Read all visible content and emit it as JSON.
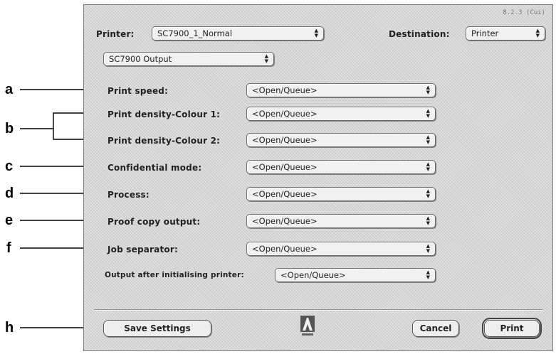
{
  "window": {
    "version_label": "8.2.3 (Cui)"
  },
  "header": {
    "printer_label": "Printer:",
    "printer_value": "SC7900_1_Normal",
    "destination_label": "Destination:",
    "destination_value": "Printer"
  },
  "panel_select": {
    "value": "SC7900 Output"
  },
  "options": [
    {
      "label": "Print speed:",
      "value": "<Open/Queue>"
    },
    {
      "label": "Print density-Colour 1:",
      "value": "<Open/Queue>"
    },
    {
      "label": "Print density-Colour 2:",
      "value": "<Open/Queue>"
    },
    {
      "label": "Confidential mode:",
      "value": "<Open/Queue>"
    },
    {
      "label": "Process:",
      "value": "<Open/Queue>"
    },
    {
      "label": "Proof copy output:",
      "value": "<Open/Queue>"
    },
    {
      "label": "Job separator:",
      "value": "<Open/Queue>"
    },
    {
      "label": "Output after initialising printer:",
      "value": "<Open/Queue>"
    }
  ],
  "buttons": {
    "save_settings": "Save Settings",
    "cancel": "Cancel",
    "print": "Print"
  },
  "callouts": [
    "a",
    "b",
    "c",
    "d",
    "e",
    "f",
    "h"
  ],
  "icons": {
    "popup_arrows": "up-down-arrows",
    "logo": "adobe-logo"
  },
  "colors": {
    "dialog_background": "#d6d6d6",
    "text": "#222222"
  }
}
